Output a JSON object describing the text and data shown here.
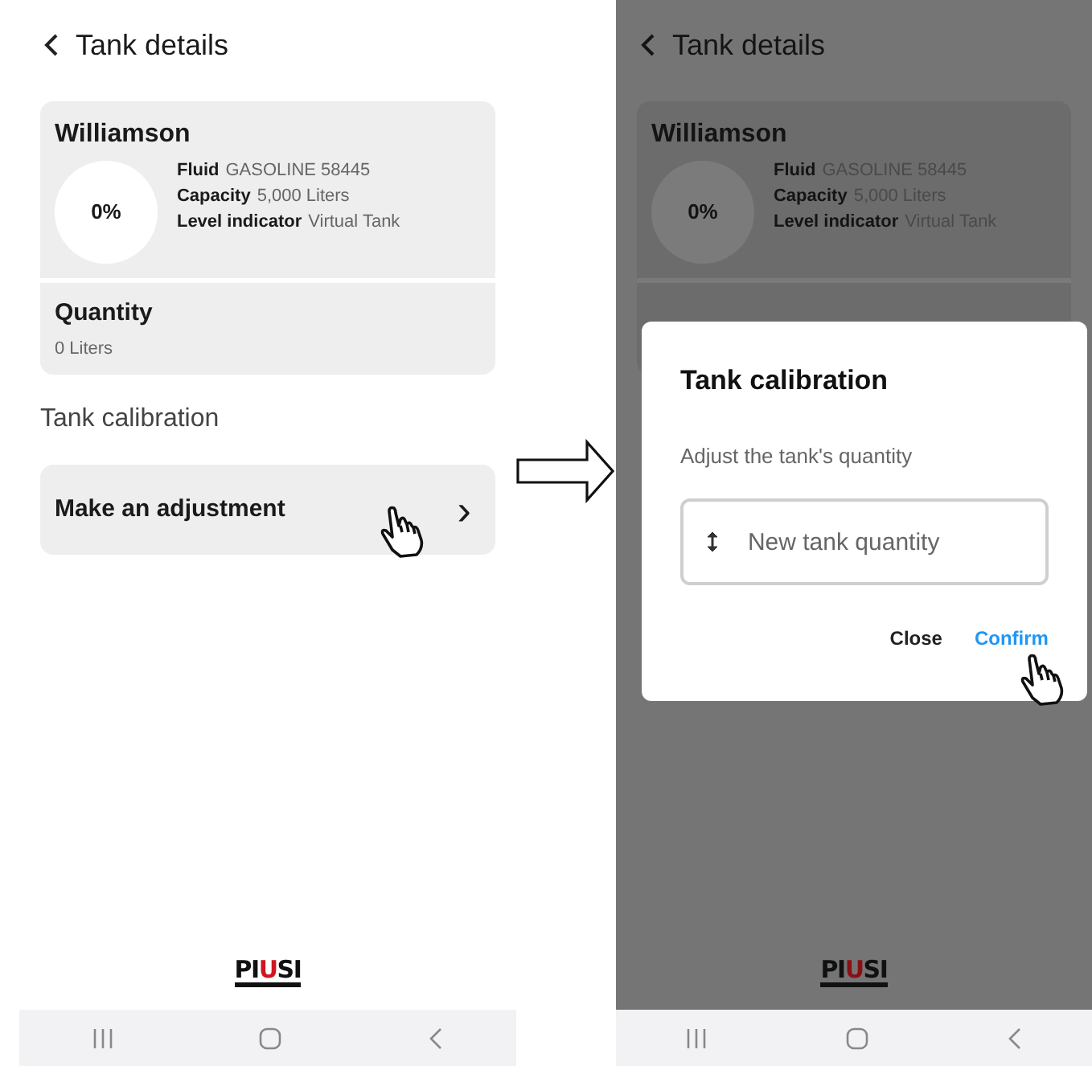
{
  "screens": [
    {
      "dimmed": false,
      "header": {
        "title": "Tank details"
      },
      "tank": {
        "name": "Williamson",
        "percent": "0%",
        "details": [
          {
            "label": "Fluid",
            "value": "GASOLINE 58445"
          },
          {
            "label": "Capacity",
            "value": "5,000 Liters"
          },
          {
            "label": "Level indicator",
            "value": "Virtual Tank"
          }
        ]
      },
      "quantity": {
        "label": "Quantity",
        "value": "0 Liters"
      },
      "section": "Tank calibration",
      "action": {
        "label": "Make an adjustment",
        "chevron": "›"
      },
      "logo": [
        {
          "text": "PI",
          "color": "#111111"
        },
        {
          "text": "U",
          "color": "#d0161e"
        },
        {
          "text": "SI",
          "color": "#111111"
        }
      ]
    },
    {
      "dimmed": true,
      "header": {
        "title": "Tank details"
      },
      "tank": {
        "name": "Williamson",
        "percent": "0%",
        "details": [
          {
            "label": "Fluid",
            "value": "GASOLINE 58445"
          },
          {
            "label": "Capacity",
            "value": "5,000 Liters"
          },
          {
            "label": "Level indicator",
            "value": "Virtual Tank"
          }
        ]
      },
      "dialog": {
        "title": "Tank calibration",
        "subtitle": "Adjust the tank's quantity",
        "field": {
          "placeholder": "New tank quantity"
        },
        "buttons": [
          {
            "label": "Close",
            "primary": false
          },
          {
            "label": "Confirm",
            "primary": true
          }
        ]
      },
      "logo": [
        {
          "text": "PI",
          "color": "#111111"
        },
        {
          "text": "U",
          "color": "#8a0f14"
        },
        {
          "text": "SI",
          "color": "#111111"
        }
      ]
    }
  ]
}
